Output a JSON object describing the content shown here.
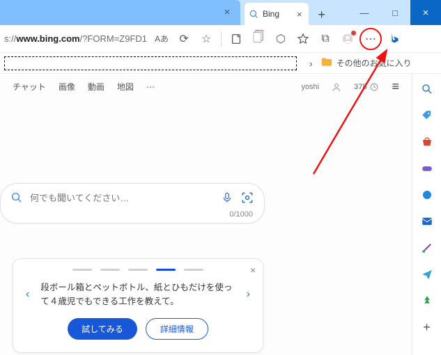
{
  "window": {
    "minimize": "—",
    "maximize": "□",
    "close": "×"
  },
  "tabs": {
    "active": {
      "title": "Bing",
      "close": "×"
    },
    "newtab": "+"
  },
  "address": {
    "prefix": "s://",
    "host": "www.bing.com",
    "suffix": "/?FORM=Z9FD1"
  },
  "toolbar": {
    "translate": "Aあ",
    "read_aloud": "⟳",
    "favorite": "☆",
    "split": "▭",
    "screenshot": "🗍",
    "extensions": "⬡",
    "favorites_hub": "✩",
    "collections": "⧉",
    "profile": "◉",
    "more": "⋯"
  },
  "bookmarks": {
    "chev": "›",
    "folder": "📁",
    "label": "その他のお気に入り"
  },
  "bing": {
    "nav": {
      "chat": "チャット",
      "images": "画像",
      "videos": "動画",
      "maps": "地図",
      "more": "⋯"
    },
    "user": {
      "name": "yoshi",
      "points": "378"
    },
    "hamburger": "≡",
    "search": {
      "placeholder": "何でも聞いてください…",
      "counter": "0/1000"
    },
    "card": {
      "text": "段ボール箱とペットボトル、紙とひもだけを使って４歳児でもできる工作を教えて。",
      "try": "試してみる",
      "details": "詳細情報",
      "prev": "‹",
      "next": "›",
      "close": "×"
    }
  },
  "sidebar": {
    "search": "🔍",
    "tag": "🔖",
    "shopping": "🛍",
    "games": "👾",
    "edge": "◈",
    "outlook": "✉",
    "tools": "📐",
    "send": "✈",
    "drop": "🌲",
    "add": "+"
  }
}
